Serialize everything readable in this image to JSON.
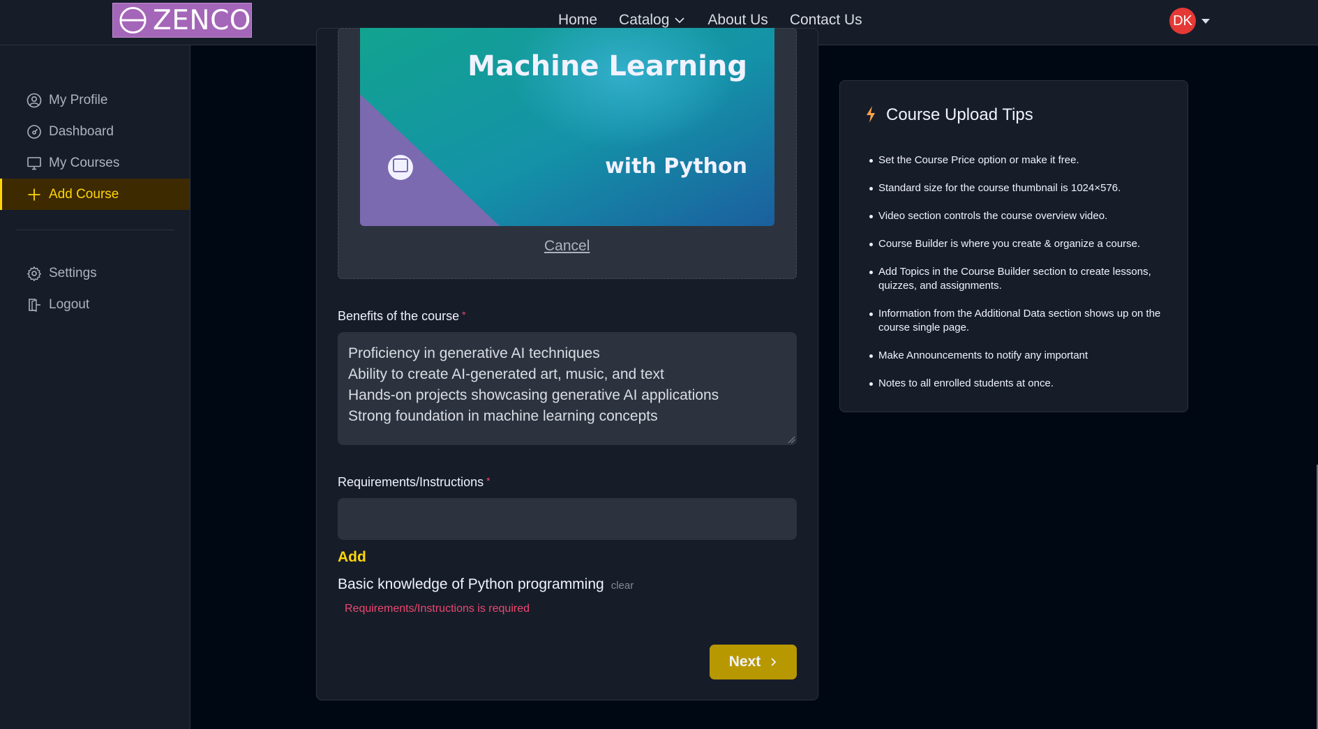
{
  "brand": {
    "name": "ZENCO"
  },
  "nav": {
    "links": [
      "Home",
      "Catalog",
      "About Us",
      "Contact Us"
    ],
    "user_initials": "DK"
  },
  "sidebar": {
    "items": [
      {
        "label": "My Profile",
        "icon": "user-circle-icon",
        "active": false
      },
      {
        "label": "Dashboard",
        "icon": "gauge-icon",
        "active": false
      },
      {
        "label": "My Courses",
        "icon": "monitor-icon",
        "active": false
      },
      {
        "label": "Add Course",
        "icon": "plus-icon",
        "active": true
      }
    ],
    "bottom_items": [
      {
        "label": "Settings",
        "icon": "gear-icon"
      },
      {
        "label": "Logout",
        "icon": "logout-icon"
      }
    ]
  },
  "form": {
    "thumbnail": {
      "title_line1": "Machine Learning",
      "title_line2": "with Python"
    },
    "cancel_label": "Cancel",
    "benefits": {
      "label": "Benefits of the course",
      "required_mark": "*",
      "value": "Proficiency in generative AI techniques\nAbility to create AI-generated art, music, and text\nHands-on projects showcasing generative AI applications\nStrong foundation in machine learning concepts"
    },
    "requirements": {
      "label": "Requirements/Instructions",
      "required_mark": "*",
      "value": "",
      "add_label": "Add",
      "items": [
        "Basic knowledge of Python programming"
      ],
      "clear_label": "clear",
      "error": "Requirements/Instructions is required"
    },
    "next_label": "Next"
  },
  "tips": {
    "title": "Course Upload Tips",
    "items": [
      "Set the Course Price option or make it free.",
      "Standard size for the course thumbnail is 1024×576.",
      "Video section controls the course overview video.",
      "Course Builder is where you create & organize a course.",
      "Add Topics in the Course Builder section to create lessons, quizzes, and assignments.",
      "Information from the Additional Data section shows up on the course single page.",
      "Make Announcements to notify any important",
      "Notes to all enrolled students at once."
    ]
  },
  "colors": {
    "accent": "#ffd60a",
    "error": "#ef476f",
    "next_button": "#b89800",
    "panel": "#161d29",
    "input": "#2c333f"
  }
}
